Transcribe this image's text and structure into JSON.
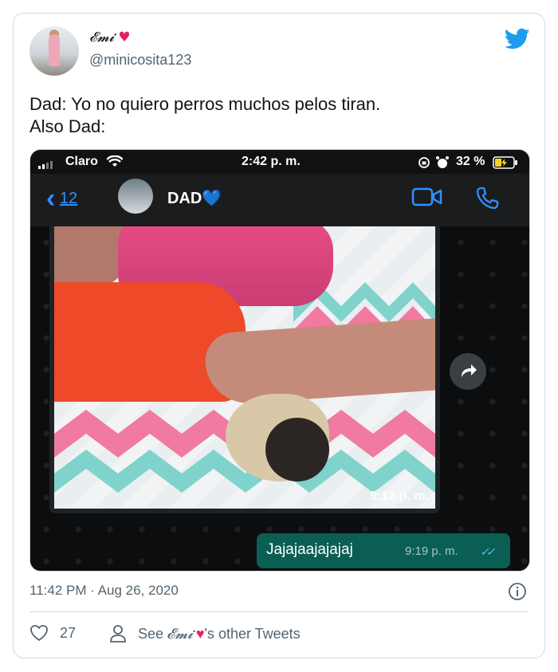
{
  "user": {
    "display_name": "𝓔𝓶𝓲",
    "name_heart": "♥",
    "handle": "@minicosita123"
  },
  "tweet": {
    "text": "Dad: Yo no quiero perros muchos pelos  tiran.\nAlso Dad:",
    "timestamp": "11:42 PM · Aug 26, 2020"
  },
  "screenshot": {
    "status_bar": {
      "carrier": "Claro",
      "time": "2:42 p. m.",
      "battery": "32 %"
    },
    "chat": {
      "back_count": "12",
      "contact_name": "DAD",
      "contact_heart": "💙"
    },
    "messages": [
      {
        "type": "photo",
        "time": "9:19 p. m."
      },
      {
        "type": "text",
        "text": "Jajajaajajajaj",
        "time": "9:19 p. m.",
        "ticks": "✓✓"
      }
    ]
  },
  "footer": {
    "like_count": "27",
    "see_prefix": "See",
    "see_name": "𝓔𝓶𝓲",
    "see_heart": "♥",
    "see_suffix": "'s other Tweets"
  },
  "colors": {
    "twitter_blue": "#1d9bf0",
    "heart_red": "#e0245e",
    "whatsapp_bubble": "#0b5e54",
    "ios_blue": "#2e8fff"
  }
}
